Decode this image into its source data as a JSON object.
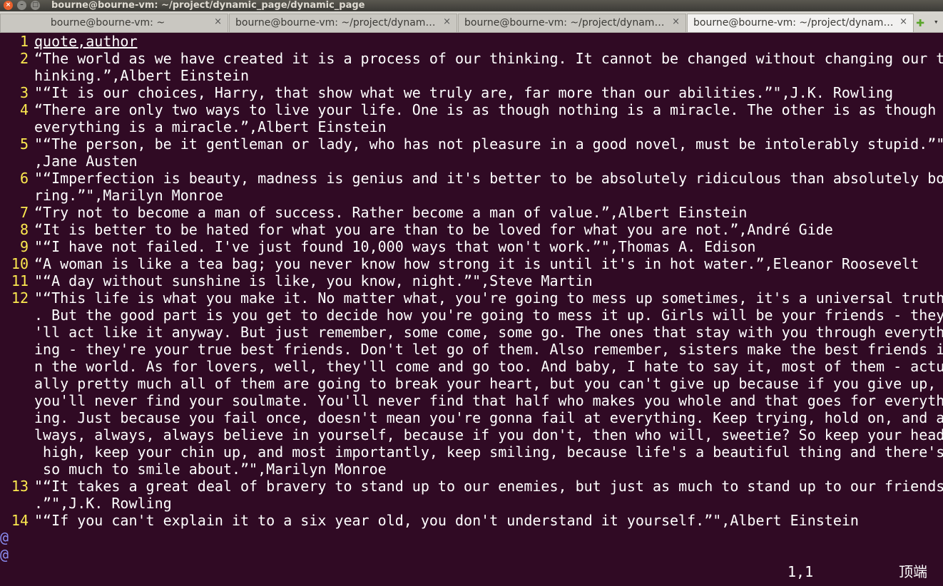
{
  "window": {
    "title": "bourne@bourne-vm: ~/project/dynamic_page/dynamic_page",
    "close_glyph": "×",
    "min_glyph": "–",
    "max_glyph": "□"
  },
  "tabs": [
    {
      "label": "bourne@bourne-vm: ~",
      "close": "×"
    },
    {
      "label": "bourne@bourne-vm: ~/project/dynamic_page",
      "close": "×"
    },
    {
      "label": "bourne@bourne-vm: ~/project/dynamic_page",
      "close": "×"
    },
    {
      "label": "bourne@bourne-vm: ~/project/dynamic_page/dynamic_page",
      "close": "×"
    }
  ],
  "tab_controls": {
    "add": "✚",
    "menu": "▾"
  },
  "editor": {
    "rows": [
      {
        "n": "1",
        "t": "quote,author"
      },
      {
        "n": "2",
        "t": "“The world as we have created it is a process of our thinking. It cannot be changed without changing our t"
      },
      {
        "n": "",
        "t": "hinking.”,Albert Einstein"
      },
      {
        "n": "3",
        "t": "\"“It is our choices, Harry, that show what we truly are, far more than our abilities.”\",J.K. Rowling"
      },
      {
        "n": "4",
        "t": "“There are only two ways to live your life. One is as though nothing is a miracle. The other is as though"
      },
      {
        "n": "",
        "t": "everything is a miracle.”,Albert Einstein"
      },
      {
        "n": "5",
        "t": "\"“The person, be it gentleman or lady, who has not pleasure in a good novel, must be intolerably stupid.”\""
      },
      {
        "n": "",
        "t": ",Jane Austen"
      },
      {
        "n": "6",
        "t": "\"“Imperfection is beauty, madness is genius and it's better to be absolutely ridiculous than absolutely bo"
      },
      {
        "n": "",
        "t": "ring.”\",Marilyn Monroe"
      },
      {
        "n": "7",
        "t": "“Try not to become a man of success. Rather become a man of value.”,Albert Einstein"
      },
      {
        "n": "8",
        "t": "“It is better to be hated for what you are than to be loved for what you are not.”,André Gide"
      },
      {
        "n": "9",
        "t": "\"“I have not failed. I've just found 10,000 ways that won't work.”\",Thomas A. Edison"
      },
      {
        "n": "10",
        "t": "“A woman is like a tea bag; you never know how strong it is until it's in hot water.”,Eleanor Roosevelt"
      },
      {
        "n": "11",
        "t": "\"“A day without sunshine is like, you know, night.”\",Steve Martin"
      },
      {
        "n": "12",
        "t": "\"“This life is what you make it. No matter what, you're going to mess up sometimes, it's a universal truth"
      },
      {
        "n": "",
        "t": ". But the good part is you get to decide how you're going to mess it up. Girls will be your friends - they"
      },
      {
        "n": "",
        "t": "'ll act like it anyway. But just remember, some come, some go. The ones that stay with you through everyth"
      },
      {
        "n": "",
        "t": "ing - they're your true best friends. Don't let go of them. Also remember, sisters make the best friends i"
      },
      {
        "n": "",
        "t": "n the world. As for lovers, well, they'll come and go too. And baby, I hate to say it, most of them - actu"
      },
      {
        "n": "",
        "t": "ally pretty much all of them are going to break your heart, but you can't give up because if you give up,"
      },
      {
        "n": "",
        "t": "you'll never find your soulmate. You'll never find that half who makes you whole and that goes for everyth"
      },
      {
        "n": "",
        "t": "ing. Just because you fail once, doesn't mean you're gonna fail at everything. Keep trying, hold on, and a"
      },
      {
        "n": "",
        "t": "lways, always, always believe in yourself, because if you don't, then who will, sweetie? So keep your head"
      },
      {
        "n": "",
        "t": " high, keep your chin up, and most importantly, keep smiling, because life's a beautiful thing and there's"
      },
      {
        "n": "",
        "t": " so much to smile about.”\",Marilyn Monroe"
      },
      {
        "n": "13",
        "t": "\"“It takes a great deal of bravery to stand up to our enemies, but just as much to stand up to our friends"
      },
      {
        "n": "",
        "t": ".”\",J.K. Rowling"
      },
      {
        "n": "14",
        "t": "\"“If you can't explain it to a six year old, you don't understand it yourself.”\",Albert Einstein"
      }
    ],
    "tildes": [
      "@",
      "@"
    ],
    "status": {
      "position": "1,1",
      "scroll": "顶端"
    }
  }
}
